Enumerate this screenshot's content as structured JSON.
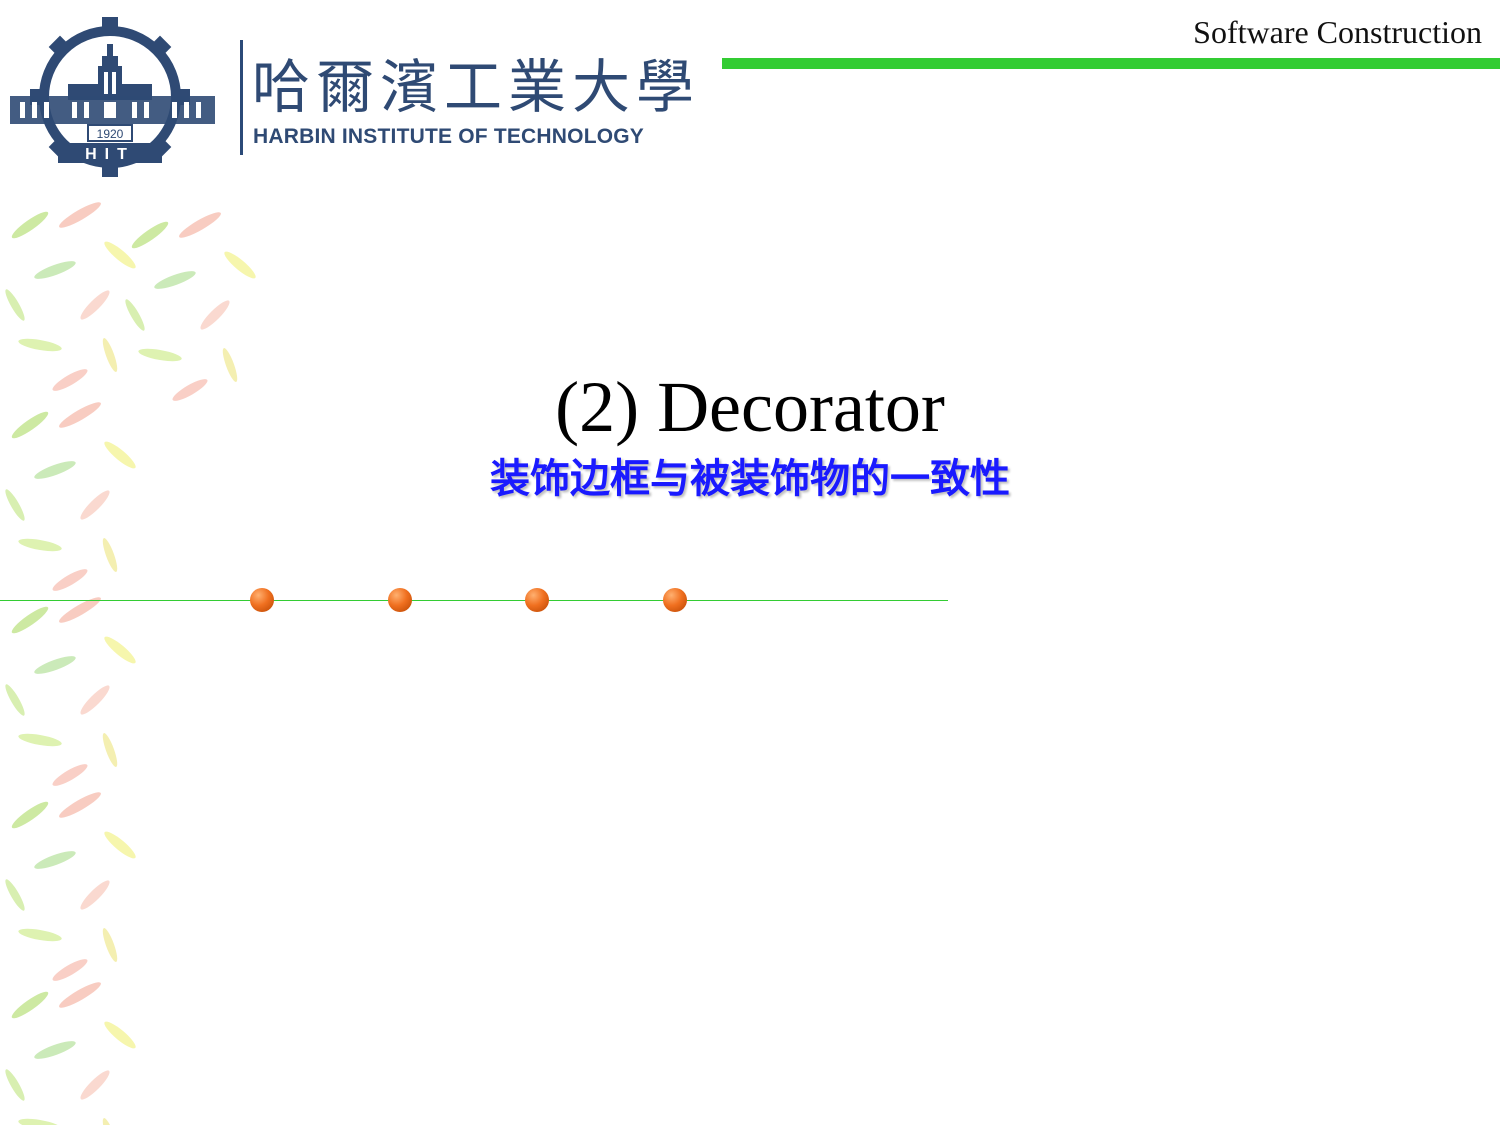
{
  "header": {
    "course_title": "Software Construction",
    "accent_color": "#33cc33",
    "logo": {
      "name_cn": "哈爾濱工業大學",
      "name_en": "HARBIN INSTITUTE OF TECHNOLOGY",
      "year": "1920",
      "abbr": "H I T"
    }
  },
  "slide": {
    "title": "(2) Decorator",
    "subtitle": "装饰边框与被装饰物的一致性",
    "subtitle_color": "#1a1aff",
    "bullet_color": "#f07020"
  }
}
